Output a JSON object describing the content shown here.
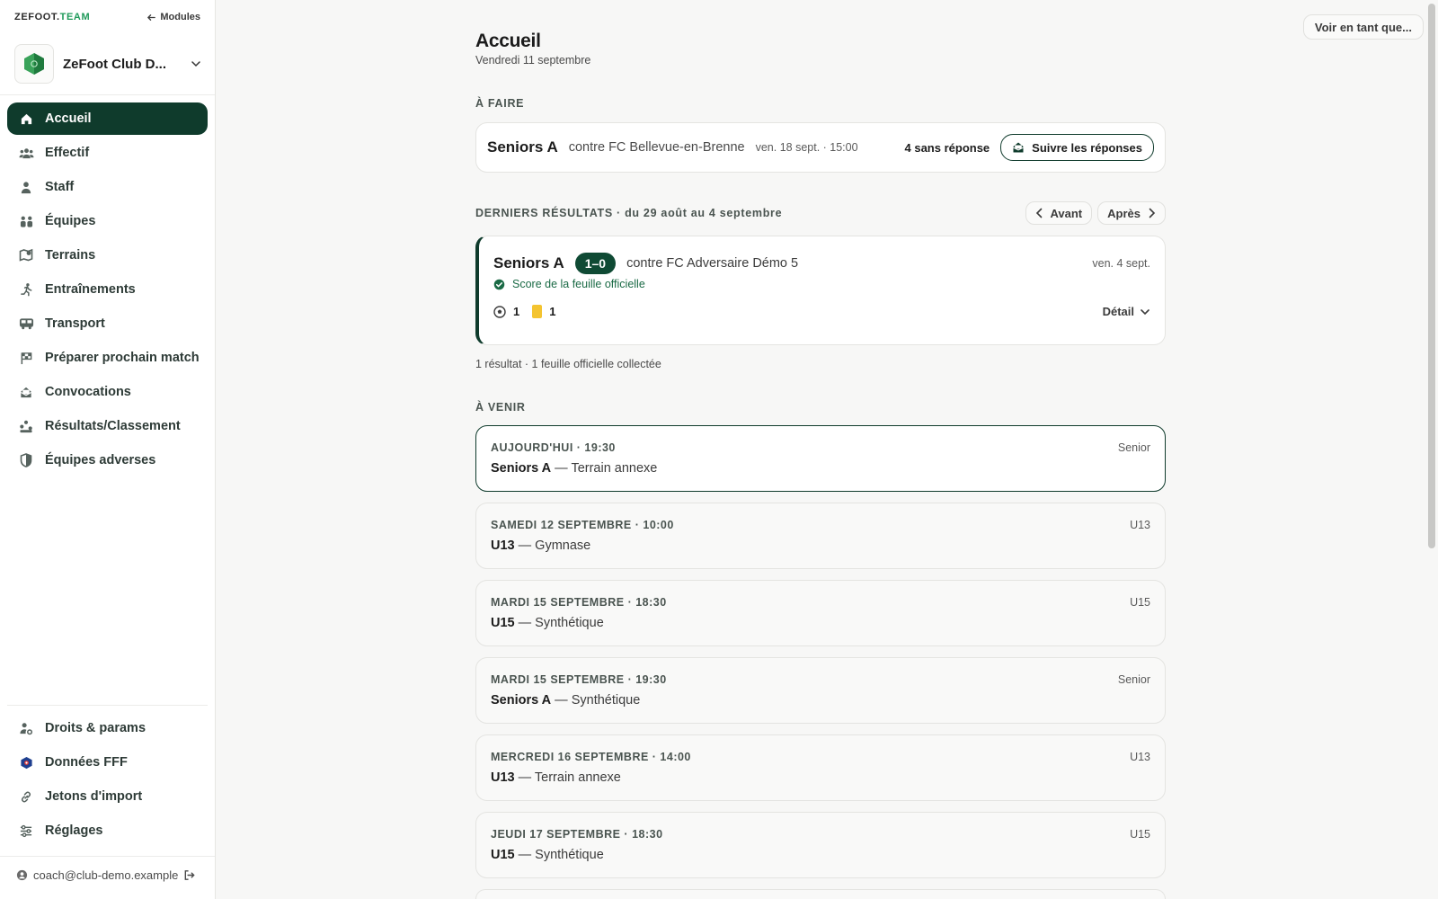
{
  "sidebar": {
    "brand_main": "ZEFOOT.",
    "brand_team": "TEAM",
    "modules_label": "Modules",
    "club_name": "ZeFoot Club D...",
    "nav": [
      {
        "label": "Accueil",
        "icon": "home-icon",
        "active": true
      },
      {
        "label": "Effectif",
        "icon": "users-icon"
      },
      {
        "label": "Staff",
        "icon": "person-icon"
      },
      {
        "label": "Équipes",
        "icon": "teams-icon"
      },
      {
        "label": "Terrains",
        "icon": "map-pin-icon"
      },
      {
        "label": "Entraînements",
        "icon": "running-icon"
      },
      {
        "label": "Transport",
        "icon": "bus-icon"
      },
      {
        "label": "Préparer prochain match",
        "icon": "flag-icon"
      },
      {
        "label": "Convocations",
        "icon": "mail-icon"
      },
      {
        "label": "Résultats/Classement",
        "icon": "podium-icon"
      },
      {
        "label": "Équipes adverses",
        "icon": "shield-icon"
      }
    ],
    "nav_bottom": [
      {
        "label": "Droits & params",
        "icon": "user-settings-icon"
      },
      {
        "label": "Données FFF",
        "icon": "fff-icon"
      },
      {
        "label": "Jetons d'import",
        "icon": "link-icon"
      },
      {
        "label": "Réglages",
        "icon": "sliders-icon"
      }
    ],
    "user_email": "coach@club-demo.example"
  },
  "header": {
    "see_as_label": "Voir en tant que...",
    "title": "Accueil",
    "date": "Vendredi 11 septembre"
  },
  "todo": {
    "section_label": "À FAIRE",
    "team": "Seniors A",
    "opponent": "contre FC Bellevue-en-Brenne",
    "when": "ven. 18 sept. · 15:00",
    "pending": "4 sans réponse",
    "follow_label": "Suivre les réponses"
  },
  "results": {
    "section_label": "DERNIERS RÉSULTATS · du 29 août au 4 septembre",
    "prev_label": "Avant",
    "next_label": "Après",
    "match": {
      "team": "Seniors A",
      "score": "1–0",
      "opponent": "contre FC Adversaire Démo 5",
      "date": "ven. 4 sept.",
      "source": "Score de la feuille officielle",
      "goals": "1",
      "yellow_cards": "1",
      "detail_label": "Détail"
    },
    "summary": "1 résultat · 1 feuille officielle collectée"
  },
  "upcoming": {
    "section_label": "À VENIR",
    "events": [
      {
        "when": "AUJOURD'HUI · 19:30",
        "team": "Seniors A",
        "place": " — Terrain annexe",
        "category": "Senior",
        "highlight": true
      },
      {
        "when": "SAMEDI 12 SEPTEMBRE · 10:00",
        "team": "U13",
        "place": " — Gymnase",
        "category": "U13"
      },
      {
        "when": "MARDI 15 SEPTEMBRE · 18:30",
        "team": "U15",
        "place": " — Synthétique",
        "category": "U15"
      },
      {
        "when": "MARDI 15 SEPTEMBRE · 19:30",
        "team": "Seniors A",
        "place": " — Synthétique",
        "category": "Senior"
      },
      {
        "when": "MERCREDI 16 SEPTEMBRE · 14:00",
        "team": "U13",
        "place": " — Terrain annexe",
        "category": "U13"
      },
      {
        "when": "JEUDI 17 SEPTEMBRE · 18:30",
        "team": "U15",
        "place": " — Synthétique",
        "category": "U15"
      }
    ]
  },
  "colors": {
    "accent": "#0f3b2c",
    "brand_green": "#1f9a5a",
    "yellow_card": "#f4c430"
  }
}
